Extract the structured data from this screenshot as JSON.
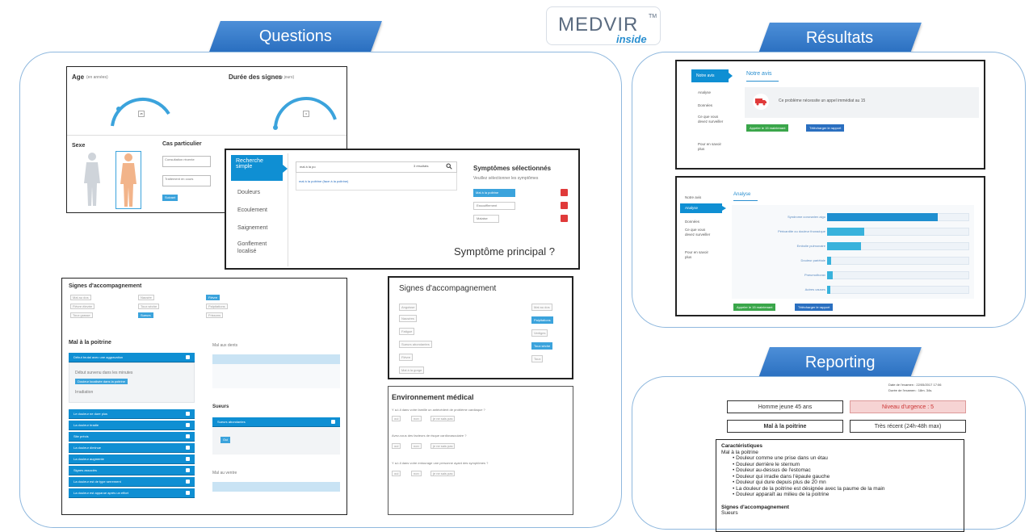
{
  "ribbons": {
    "questions": "Questions",
    "resultats": "Résultats",
    "reporting": "Reporting"
  },
  "logo": {
    "main": "MEDVIR",
    "tm": "TM",
    "sub": "inside"
  },
  "age_card": {
    "title": "Age",
    "unit": "(en années)",
    "value": "45"
  },
  "duree_card": {
    "title": "Durée des signes",
    "unit": "(en jours)",
    "value": "3"
  },
  "sexe_card": {
    "title": "Sexe",
    "cas_title": "Cas particulier",
    "cas_options": [
      "Consultation récente",
      "Traitement en cours"
    ],
    "cas_button": "Suivant"
  },
  "search_panel": {
    "sidebar": [
      "Recherche simple",
      "Douleurs",
      "Ecoulement",
      "Saignement",
      "Gonflement localisé"
    ],
    "search_value": "mal à la po",
    "results_count": "3 résultats",
    "suggestion": "mal à la poitrine (face à la poitrine)",
    "selected_title": "Symptômes sélectionnés",
    "selected_sub": "Veuillez sélectionner les symptômes",
    "selected_items": [
      "Mal à la poitrine",
      "Essoufflement",
      "Malaise"
    ],
    "principal": "Symptôme principal ?"
  },
  "signes_left": {
    "title": "Signes d'accompagnement",
    "checks": [
      "Mal au dos",
      "Nausée",
      "Fièvre",
      "Fièvre élevée",
      "Toux sèche",
      "Palpitations",
      "Toux grasse",
      "Sueurs",
      "Frissons",
      "Mal de gorge"
    ],
    "section": "Mal à la poitrine",
    "accordion_main": "Début brutal avec une aggravation",
    "accordion_items": [
      "Le douleur ne dure plus",
      "La douleur irradie",
      "Site précis",
      "La douleur diminue",
      "La douleur augmente",
      "Signes associés",
      "La douleur est de type serrement",
      "La douleur est apparue après un effort"
    ],
    "sub_items": [
      "Début survenu dans les minutes",
      "Douleur localisée dans la poitrine",
      "Irradiation"
    ],
    "right_title1": "Mal aux dents",
    "right_title2": "Sueurs",
    "right_bar": "Sueurs abondantes",
    "right_chip": "Oui",
    "right_title3": "Mal au ventre"
  },
  "signes_right": {
    "title": "Signes d'accompagnement",
    "left_checks": [
      "Angoisse",
      "Nausées",
      "Fatigue",
      "Sueurs abondantes",
      "Fièvre",
      "Mal à la gorge"
    ],
    "right_checks": [
      "Mal au dos",
      "Palpitations",
      "Vertiges",
      "Toux sèche",
      "Toux"
    ]
  },
  "env": {
    "title": "Environnement médical",
    "q1": "Y a-t-il dans votre famille un antécédent de problème cardiaque ?",
    "q2": "Avez-vous des facteurs de risque cardiovasculaire ?",
    "q3": "Y a-t-il dans votre entourage une personne ayant des symptômes ?",
    "answers": [
      "oui",
      "non",
      "je ne sais pas"
    ]
  },
  "res1": {
    "sidebar": [
      "Notre avis",
      "Analyse",
      "Données",
      "Ce que vous devez surveiller",
      "Pour en savoir plus"
    ],
    "title": "Notre avis",
    "message": "Ce problème nécessite un appel immédiat au 15",
    "btn_green": "Appeler le 15 maintenant",
    "btn_blue": "Télécharger le rapport"
  },
  "res2": {
    "sidebar": [
      "Notre avis",
      "Analyse",
      "Données",
      "Ce que vous devez surveiller",
      "Pour en savoir plus"
    ],
    "title": "Analyse",
    "bars": [
      {
        "label": "Syndrome coronarien aigu",
        "value": 78
      },
      {
        "label": "Péricardite ou douleur thoracique",
        "value": 26
      },
      {
        "label": "Embolie pulmonaire",
        "value": 24
      },
      {
        "label": "Douleur pariétale",
        "value": 3
      },
      {
        "label": "Pneumothorax",
        "value": 4
      },
      {
        "label": "Autres causes",
        "value": 2
      }
    ],
    "btn_green": "Appeler le 15 maintenant",
    "btn_blue": "Télécharger le rapport"
  },
  "report": {
    "meta1": "Date de l'examen : 22/05/2017 17:06",
    "meta2": "Durée de l'examen : 18m. 34s.",
    "box1": "Homme jeune 45 ans",
    "box2": "Niveau d'urgence : 5",
    "box3": "Mal à la poitrine",
    "box4": "Très récent (24h-48h max)",
    "car_title": "Caractéristiques",
    "car_sub": "Mal à la poitrine",
    "car_items": [
      "Douleur comme une prise dans un étau",
      "Douleur derrière le sternum",
      "Douleur au-dessus de l'estomac",
      "Douleur qui irradie dans l'épaule gauche",
      "Douleur qui dure depuis plus de 20 mn",
      "La douleur de la poitrine est désignée avec la paume de la main",
      "Douleur apparaît au milieu de la poitrine"
    ],
    "sig_title": "Signes d'accompagnement",
    "sig_sub": "Sueurs"
  },
  "colors": {
    "accent": "#0f8fd3",
    "ribbon": "#2a6fc0",
    "panel_border": "#8fb8de",
    "urgent": "#e03a3a"
  }
}
